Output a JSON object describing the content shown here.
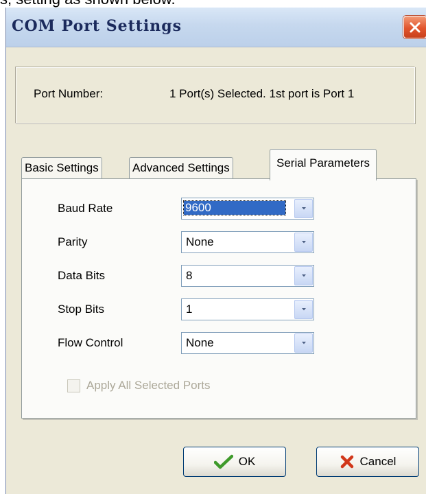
{
  "caption": "s, setting as shown below.",
  "window": {
    "title": "COM Port Settings"
  },
  "port": {
    "label": "Port Number:",
    "value": "1 Port(s) Selected. 1st port is Port 1"
  },
  "tabs": [
    {
      "label": "Basic Settings",
      "active": false
    },
    {
      "label": "Advanced Settings",
      "active": false
    },
    {
      "label": "Serial Parameters",
      "active": true
    }
  ],
  "fields": [
    {
      "label": "Baud Rate",
      "value": "9600"
    },
    {
      "label": "Parity",
      "value": "None"
    },
    {
      "label": "Data Bits",
      "value": "8"
    },
    {
      "label": "Stop Bits",
      "value": "1"
    },
    {
      "label": "Flow Control",
      "value": "None"
    }
  ],
  "apply_all": {
    "label": "Apply All Selected Ports",
    "checked": false,
    "enabled": false
  },
  "buttons": {
    "ok": "OK",
    "cancel": "Cancel"
  },
  "icons": {
    "close": "close-icon",
    "ok": "checkmark-icon",
    "cancel": "x-icon",
    "dropdown": "chevron-down-icon"
  },
  "colors": {
    "selection": "#316ac5",
    "close": "#e2552d",
    "face": "#ece9d8"
  }
}
